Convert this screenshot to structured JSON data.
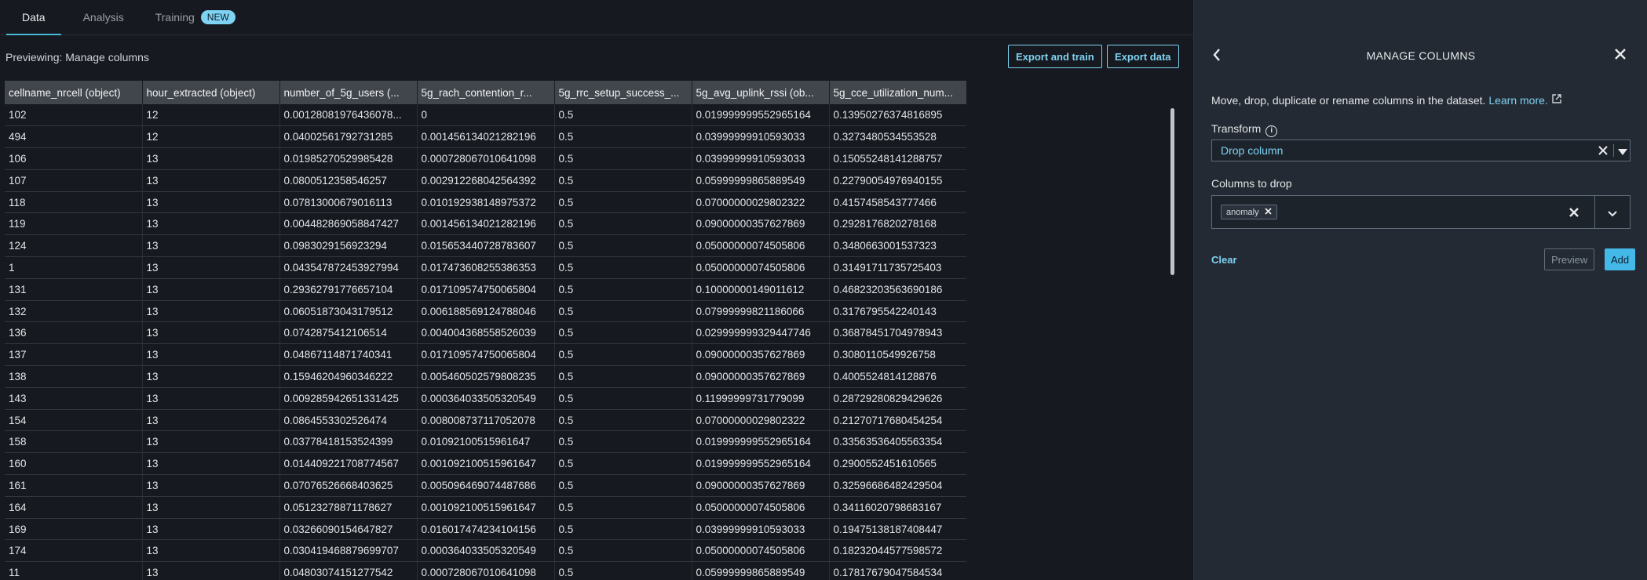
{
  "tabs": [
    {
      "label": "Data"
    },
    {
      "label": "Analysis"
    },
    {
      "label": "Training",
      "badge": "NEW"
    }
  ],
  "preview_title": "Previewing: Manage columns",
  "buttons": {
    "export_train": "Export and train",
    "export_data": "Export data"
  },
  "table": {
    "columns": [
      "cellname_nrcell (object)",
      "hour_extracted (object)",
      "number_of_5g_users (...",
      "5g_rach_contention_r...",
      "5g_rrc_setup_success_...",
      "5g_avg_uplink_rssi (ob...",
      "5g_cce_utilization_num..."
    ],
    "rows": [
      [
        "102",
        "12",
        "0.00128081976436078...",
        "0",
        "0.5",
        "0.019999999552965164",
        "0.13950276374816895"
      ],
      [
        "494",
        "12",
        "0.04002561792731285",
        "0.001456134021282196",
        "0.5",
        "0.03999999910593033",
        "0.3273480534553528"
      ],
      [
        "106",
        "13",
        "0.01985270529985428",
        "0.000728067010641098",
        "0.5",
        "0.03999999910593033",
        "0.15055248141288757"
      ],
      [
        "107",
        "13",
        "0.0800512358546257",
        "0.002912268042564392",
        "0.5",
        "0.05999999865889549",
        "0.22790054976940155"
      ],
      [
        "118",
        "13",
        "0.07813000679016113",
        "0.010192938148975372",
        "0.5",
        "0.07000000029802322",
        "0.4157458543777466"
      ],
      [
        "119",
        "13",
        "0.004482869058847427",
        "0.001456134021282196",
        "0.5",
        "0.09000000357627869",
        "0.2928176820278168"
      ],
      [
        "124",
        "13",
        "0.0983029156923294",
        "0.015653440728783607",
        "0.5",
        "0.05000000074505806",
        "0.3480663001537323"
      ],
      [
        "1",
        "13",
        "0.043547872453927994",
        "0.017473608255386353",
        "0.5",
        "0.05000000074505806",
        "0.31491711735725403"
      ],
      [
        "131",
        "13",
        "0.29362791776657104",
        "0.017109574750065804",
        "0.5",
        "0.10000000149011612",
        "0.46823203563690186"
      ],
      [
        "132",
        "13",
        "0.06051873043179512",
        "0.006188569124788046",
        "0.5",
        "0.07999999821186066",
        "0.3176795542240143"
      ],
      [
        "136",
        "13",
        "0.0742875412106514",
        "0.004004368558526039",
        "0.5",
        "0.029999999329447746",
        "0.36878451704978943"
      ],
      [
        "137",
        "13",
        "0.04867114871740341",
        "0.017109574750065804",
        "0.5",
        "0.09000000357627869",
        "0.3080110549926758"
      ],
      [
        "138",
        "13",
        "0.15946204960346222",
        "0.005460502579808235",
        "0.5",
        "0.09000000357627869",
        "0.4005524814128876"
      ],
      [
        "143",
        "13",
        "0.009285942651331425",
        "0.000364033505320549",
        "0.5",
        "0.11999999731779099",
        "0.28729280829429626"
      ],
      [
        "154",
        "13",
        "0.0864553302526474",
        "0.008008737117052078",
        "0.5",
        "0.07000000029802322",
        "0.21270717680454254"
      ],
      [
        "158",
        "13",
        "0.03778418153524399",
        "0.01092100515961647",
        "0.5",
        "0.019999999552965164",
        "0.33563536405563354"
      ],
      [
        "160",
        "13",
        "0.014409221708774567",
        "0.001092100515961647",
        "0.5",
        "0.019999999552965164",
        "0.2900552451610565"
      ],
      [
        "161",
        "13",
        "0.07076526668403625",
        "0.005096469074487686",
        "0.5",
        "0.09000000357627869",
        "0.32596686482429504"
      ],
      [
        "164",
        "13",
        "0.05123278871178627",
        "0.001092100515961647",
        "0.5",
        "0.05000000074505806",
        "0.34116020798683167"
      ],
      [
        "169",
        "13",
        "0.03266090154647827",
        "0.016017474234104156",
        "0.5",
        "0.03999999910593033",
        "0.19475138187408447"
      ],
      [
        "174",
        "13",
        "0.030419468879699707",
        "0.000364033505320549",
        "0.5",
        "0.05000000074505806",
        "0.18232044577598572"
      ],
      [
        "11",
        "13",
        "0.04803074151277542",
        "0.000728067010641098",
        "0.5",
        "0.05999999865889549",
        "0.17817679047584534"
      ]
    ]
  },
  "panel": {
    "title": "MANAGE COLUMNS",
    "description": "Move, drop, duplicate or rename columns in the dataset.",
    "learn_more": "Learn more.",
    "transform_label": "Transform",
    "transform_value": "Drop column",
    "columns_label": "Columns to drop",
    "chip": "anomaly",
    "clear": "Clear",
    "preview": "Preview",
    "add": "Add"
  },
  "colors": {
    "accent": "#7fd3f2",
    "panel_bg": "#232a33",
    "page_bg": "#16191f"
  }
}
